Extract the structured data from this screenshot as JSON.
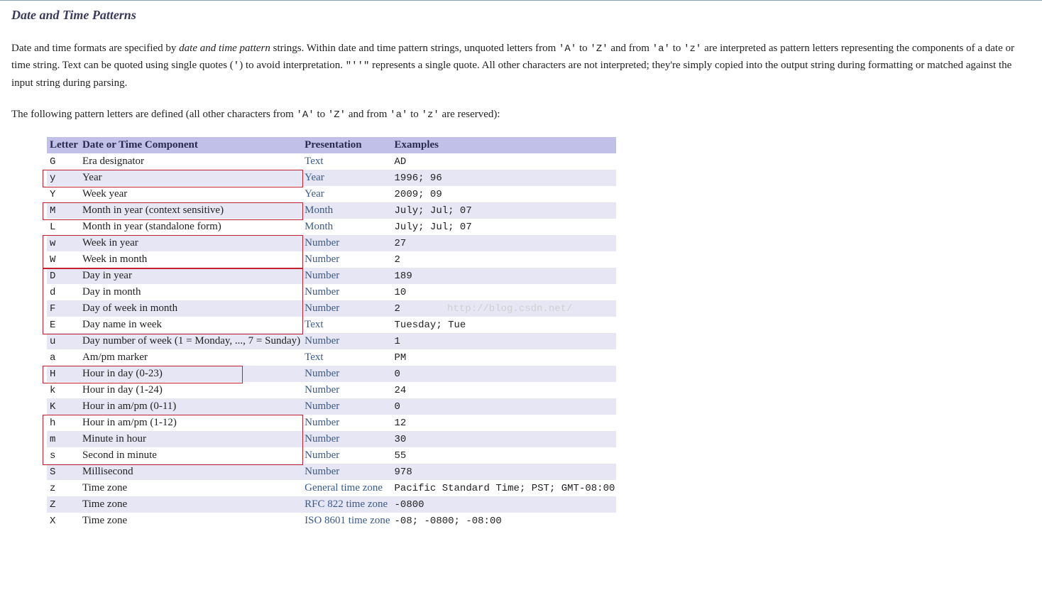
{
  "title": "Date and Time Patterns",
  "intro1_a": "Date and time formats are specified by ",
  "intro1_em": "date and time pattern",
  "intro1_b": " strings. Within date and time pattern strings, unquoted letters from ",
  "intro1_codeA": "'A'",
  "intro1_c": " to ",
  "intro1_codeZ": "'Z'",
  "intro1_d": " and from ",
  "intro1_codea": "'a'",
  "intro1_e": " to ",
  "intro1_codez": "'z'",
  "intro1_f": " are interpreted as pattern letters representing the components of a date or time string. Text can be quoted using single quotes (",
  "intro1_codeQuote": "'",
  "intro1_g": ") to avoid interpretation. ",
  "intro1_codeDQ": "\"''\"",
  "intro1_h": " represents a single quote. All other characters are not interpreted; they're simply copied into the output string during formatting or matched against the input string during parsing.",
  "intro2_a": "The following pattern letters are defined (all other characters from ",
  "intro2_codeA": "'A'",
  "intro2_b": " to ",
  "intro2_codeZ": "'Z'",
  "intro2_c": " and from ",
  "intro2_codea": "'a'",
  "intro2_d": " to ",
  "intro2_codez": "'z'",
  "intro2_e": " are reserved):",
  "headers": {
    "letter": "Letter",
    "comp": "Date or Time Component",
    "pres": "Presentation",
    "ex": "Examples"
  },
  "rows": [
    {
      "letter": "G",
      "comp": "Era designator",
      "pres": "Text",
      "ex": "AD"
    },
    {
      "letter": "y",
      "comp": "Year",
      "pres": "Year",
      "ex": "1996; 96"
    },
    {
      "letter": "Y",
      "comp": "Week year",
      "pres": "Year",
      "ex": "2009; 09"
    },
    {
      "letter": "M",
      "comp": "Month in year (context sensitive)",
      "pres": "Month",
      "ex": "July; Jul; 07"
    },
    {
      "letter": "L",
      "comp": "Month in year (standalone form)",
      "pres": "Month",
      "ex": "July; Jul; 07"
    },
    {
      "letter": "w",
      "comp": "Week in year",
      "pres": "Number",
      "ex": "27"
    },
    {
      "letter": "W",
      "comp": "Week in month",
      "pres": "Number",
      "ex": "2"
    },
    {
      "letter": "D",
      "comp": "Day in year",
      "pres": "Number",
      "ex": "189"
    },
    {
      "letter": "d",
      "comp": "Day in month",
      "pres": "Number",
      "ex": "10"
    },
    {
      "letter": "F",
      "comp": "Day of week in month",
      "pres": "Number",
      "ex": "2"
    },
    {
      "letter": "E",
      "comp": "Day name in week",
      "pres": "Text",
      "ex": "Tuesday; Tue"
    },
    {
      "letter": "u",
      "comp": "Day number of week (1 = Monday, ..., 7 = Sunday)",
      "pres": "Number",
      "ex": "1"
    },
    {
      "letter": "a",
      "comp": "Am/pm marker",
      "pres": "Text",
      "ex": "PM"
    },
    {
      "letter": "H",
      "comp": "Hour in day (0-23)",
      "pres": "Number",
      "ex": "0"
    },
    {
      "letter": "k",
      "comp": "Hour in day (1-24)",
      "pres": "Number",
      "ex": "24"
    },
    {
      "letter": "K",
      "comp": "Hour in am/pm (0-11)",
      "pres": "Number",
      "ex": "0"
    },
    {
      "letter": "h",
      "comp": "Hour in am/pm (1-12)",
      "pres": "Number",
      "ex": "12"
    },
    {
      "letter": "m",
      "comp": "Minute in hour",
      "pres": "Number",
      "ex": "30"
    },
    {
      "letter": "s",
      "comp": "Second in minute",
      "pres": "Number",
      "ex": "55"
    },
    {
      "letter": "S",
      "comp": "Millisecond",
      "pres": "Number",
      "ex": "978"
    },
    {
      "letter": "z",
      "comp": "Time zone",
      "pres": "General time zone",
      "ex": "Pacific Standard Time; PST; GMT-08:00"
    },
    {
      "letter": "Z",
      "comp": "Time zone",
      "pres": "RFC 822 time zone",
      "ex": "-0800"
    },
    {
      "letter": "X",
      "comp": "Time zone",
      "pres": "ISO 8601 time zone",
      "ex": "-08; -0800; -08:00"
    }
  ],
  "watermark": "http://blog.csdn.net/"
}
